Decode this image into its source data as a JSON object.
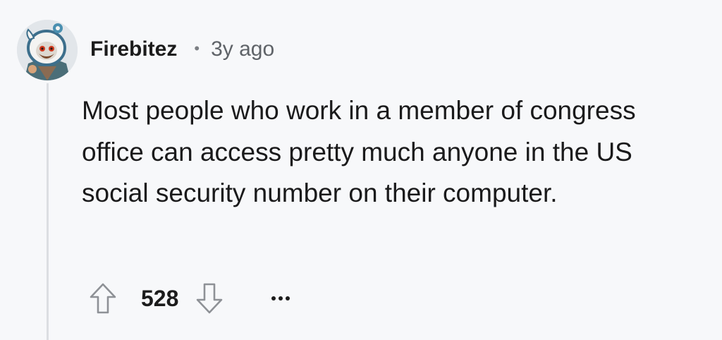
{
  "comment": {
    "username": "Firebitez",
    "separator": "•",
    "timestamp": "3y ago",
    "body": "Most people who work in a member of congress office can access pretty much anyone in the US social security number on their computer.",
    "score": "528"
  },
  "icons": {
    "upvote": "arrow-up-outline-icon",
    "downvote": "arrow-down-outline-icon",
    "more": "ellipsis-icon"
  },
  "colors": {
    "background": "#f7f8fa",
    "thread_line": "#dcdee2",
    "text": "#1a1a1b",
    "meta": "#5f6368"
  }
}
